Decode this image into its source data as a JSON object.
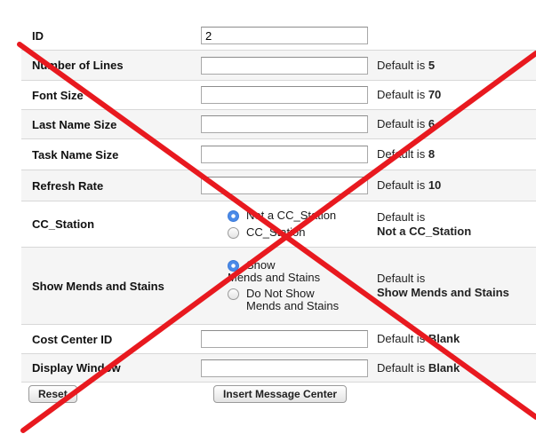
{
  "rows": {
    "id": {
      "label": "ID",
      "value": "2"
    },
    "number_of_lines": {
      "label": "Number of Lines",
      "value": "",
      "note_prefix": "Default is ",
      "note_value": "5"
    },
    "font_size": {
      "label": "Font Size",
      "value": "",
      "note_prefix": "Default is ",
      "note_value": "70"
    },
    "last_name_size": {
      "label": "Last Name Size",
      "value": "",
      "note_prefix": "Default is ",
      "note_value": "6"
    },
    "task_name_size": {
      "label": "Task Name Size",
      "value": "",
      "note_prefix": "Default is ",
      "note_value": "8"
    },
    "refresh_rate": {
      "label": "Refresh Rate",
      "value": "",
      "note_prefix": "Default is ",
      "note_value": "10"
    },
    "cc_station": {
      "label": "CC_Station",
      "options": [
        "Not a CC_Station",
        "CC_Station"
      ],
      "selected": "Not a CC_Station",
      "note_prefix": "Default is",
      "note_value": "Not a CC_Station"
    },
    "show_mends": {
      "label": "Show Mends and Stains",
      "option1_line1": "Show",
      "option1_line2": "Mends and Stains",
      "option2_line1": "Do Not Show",
      "option2_line2": "Mends and Stains",
      "selected": "Show Mends and Stains",
      "note_prefix": "Default is",
      "note_value": "Show Mends and Stains"
    },
    "cost_center_id": {
      "label": "Cost Center ID",
      "value": "",
      "note_prefix": "Default is ",
      "note_value": "Blank"
    },
    "display_window": {
      "label": "Display Window",
      "value": "",
      "note_prefix": "Default is ",
      "note_value": "Blank"
    }
  },
  "buttons": {
    "reset": "Reset",
    "insert": "Insert Message Center"
  },
  "overlay": {
    "mark": "red-x-cross",
    "color": "#e8191f"
  }
}
